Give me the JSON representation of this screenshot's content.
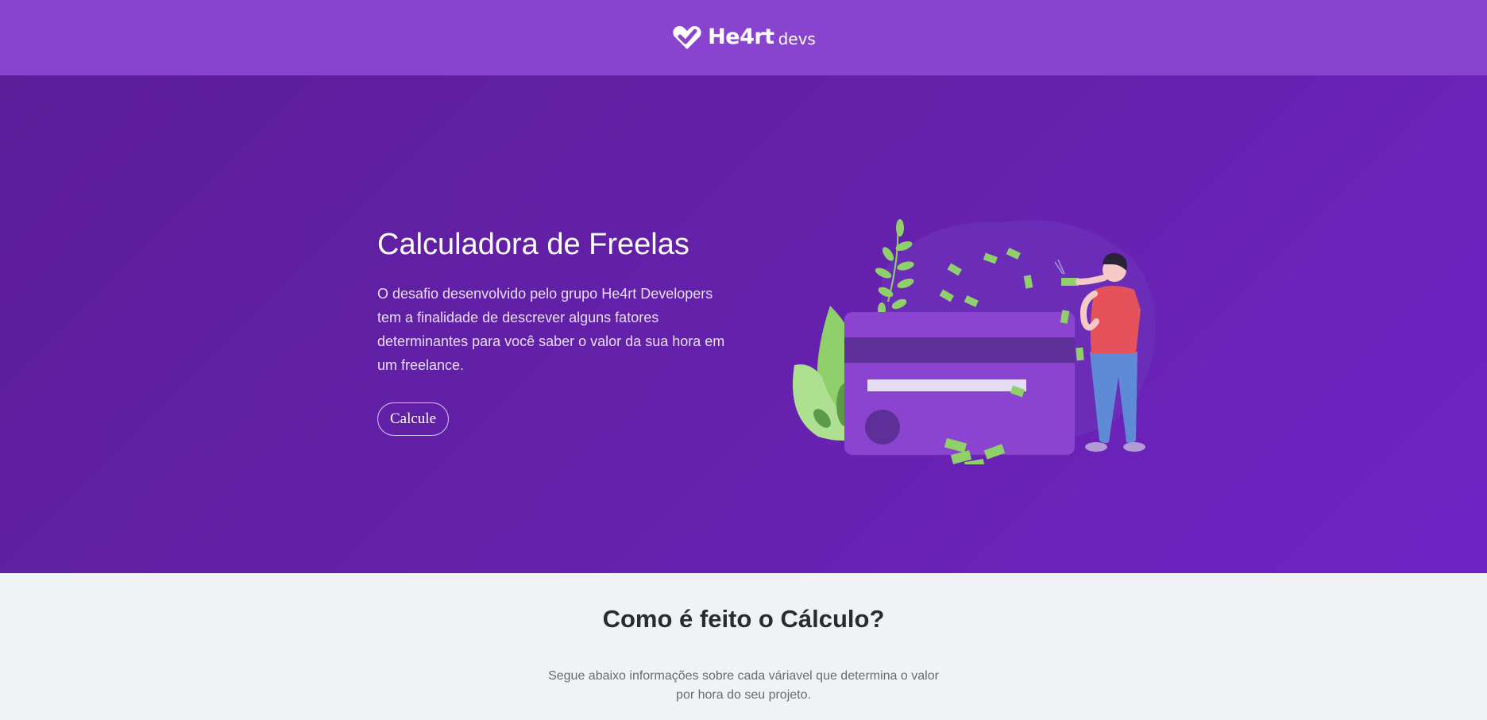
{
  "header": {
    "logo_name": "He4rt",
    "logo_suffix": "devs"
  },
  "hero": {
    "title": "Calculadora de Freelas",
    "description": "O desafio desenvolvido pelo grupo He4rt Developers tem a finalidade de descrever alguns fatores determinantes para você saber o valor da sua hora em um freelance.",
    "button_label": "Calcule",
    "illustration": "credit-card-money-illustration"
  },
  "calculation": {
    "title": "Como é feito o Cálculo?",
    "description": "Segue abaixo informações sobre cada váriavel que determina o valor por hora do seu projeto."
  },
  "colors": {
    "header_bg": "#8944cf",
    "hero_bg": "#6421ab",
    "section_bg": "#eff3f6"
  }
}
